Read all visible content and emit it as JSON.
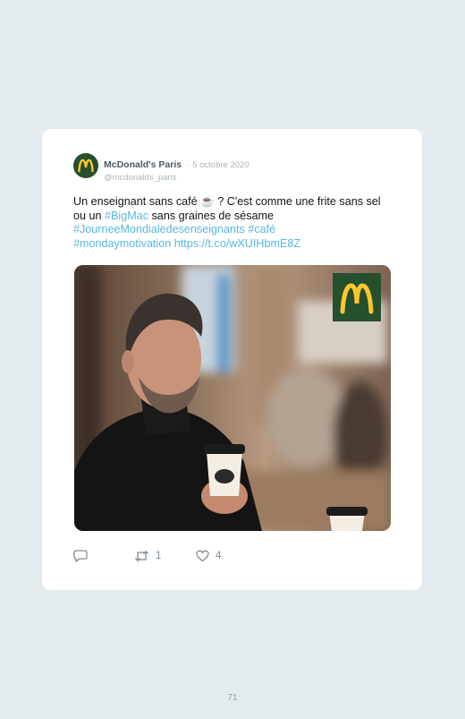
{
  "tweet": {
    "display_name": "McDonald's Paris",
    "separator": "·",
    "date": "5 octobre 2020",
    "handle": "@mcdonalds_paris",
    "text": {
      "part1": "Un enseignant sans café ☕ ? C'est comme une frite sans sel ou un ",
      "hashtag_bigmac": "#BigMac",
      "part2": " sans graines de sésame",
      "hashtag_journee": "#JourneeMondialedesenseignants",
      "hashtag_cafe": "#café",
      "hashtag_monday": "#mondaymotivation",
      "link": "https://t.co/wXUIHbmE8Z"
    },
    "media": {
      "logo": "mcdonalds-golden-arches",
      "cup_brand": "McCafé"
    },
    "actions": {
      "reply_icon": "speech-bubble-icon",
      "retweet_icon": "retweet-icon",
      "retweet_count": "1",
      "like_icon": "heart-icon",
      "like_count": "4"
    }
  },
  "page": {
    "number": "71"
  },
  "colors": {
    "background": "#e3ebee",
    "card": "#ffffff",
    "link": "#5ab7e0",
    "brand_green": "#264f2e",
    "brand_yellow": "#ffc72c"
  }
}
